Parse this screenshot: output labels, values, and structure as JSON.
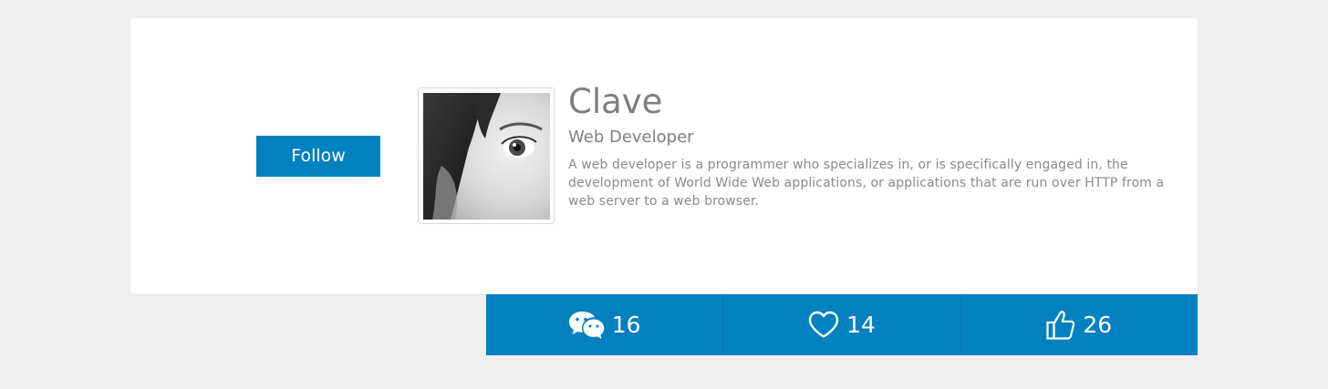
{
  "profile": {
    "follow_label": "Follow",
    "name": "Clave",
    "role": "Web Developer",
    "description": "A web developer is a programmer who specializes in, or is specifically engaged in, the development of World Wide Web applications, or applications that are run over HTTP from a web server to a web browser."
  },
  "stats": [
    {
      "icon": "chat-bubbles-icon",
      "count": "16"
    },
    {
      "icon": "heart-icon",
      "count": "14"
    },
    {
      "icon": "thumbs-up-icon",
      "count": "26"
    }
  ],
  "colors": {
    "accent": "#0281c1",
    "background": "#f0f0f0",
    "card": "#ffffff",
    "text_muted": "#7f7f7f"
  }
}
